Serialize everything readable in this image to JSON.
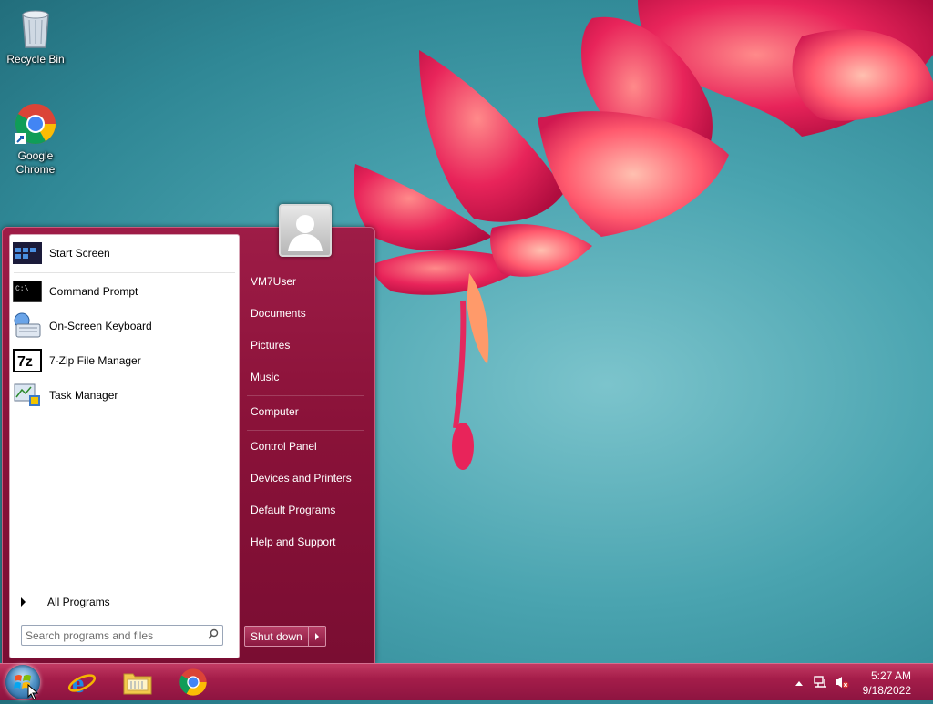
{
  "desktop": {
    "icons": [
      {
        "label": "Recycle Bin",
        "icon": "recycle-bin-icon"
      },
      {
        "label": "Google\nChrome",
        "label_line1": "Google",
        "label_line2": "Chrome",
        "icon": "chrome-icon"
      }
    ]
  },
  "start_menu": {
    "programs": [
      {
        "label": "Start Screen",
        "icon": "start-screen-icon"
      },
      {
        "label": "Command Prompt",
        "icon": "command-prompt-icon"
      },
      {
        "label": "On-Screen Keyboard",
        "icon": "keyboard-icon"
      },
      {
        "label": "7-Zip File Manager",
        "icon": "seven-zip-icon",
        "icon_text": "7z"
      },
      {
        "label": "Task Manager",
        "icon": "task-manager-icon"
      }
    ],
    "all_programs_label": "All Programs",
    "search_placeholder": "Search programs and files",
    "right_items": [
      {
        "label": "VM7User"
      },
      {
        "label": "Documents"
      },
      {
        "label": "Pictures"
      },
      {
        "label": "Music"
      },
      {
        "label": "Computer"
      },
      {
        "label": "Control Panel"
      },
      {
        "label": "Devices and Printers"
      },
      {
        "label": "Default Programs"
      },
      {
        "label": "Help and Support"
      }
    ],
    "shutdown_label": "Shut down",
    "cmd_icon_text": "C:\\_"
  },
  "taskbar": {
    "pinned": [
      {
        "icon": "internet-explorer-icon"
      },
      {
        "icon": "file-explorer-icon"
      },
      {
        "icon": "chrome-icon"
      }
    ],
    "tray": {
      "time": "5:27 AM",
      "date": "9/18/2022",
      "icons": [
        "show-hidden-icons-icon",
        "network-icon",
        "volume-muted-icon"
      ]
    }
  },
  "colors": {
    "accent": "#9e1c47",
    "taskbar": "#a51d4a",
    "wallpaper": "#4aa4b0"
  }
}
